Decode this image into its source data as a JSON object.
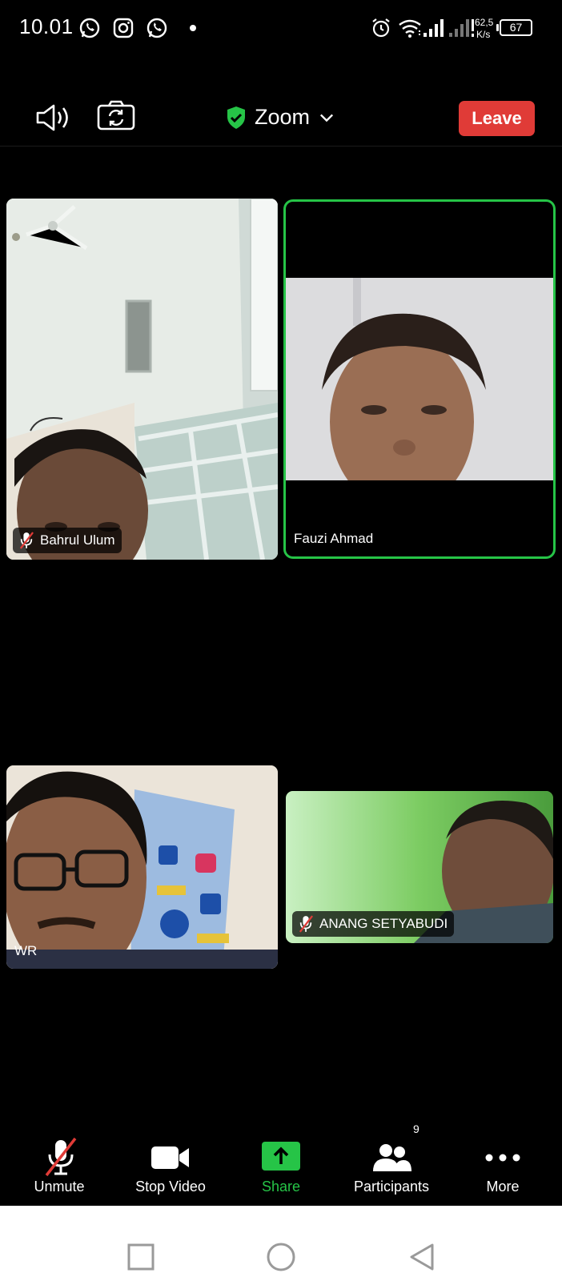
{
  "status_bar": {
    "time": "10.01",
    "net_speed_value": "62,5",
    "net_speed_unit": "K/s",
    "battery": "67",
    "notification_icons": [
      "whatsapp-icon",
      "instagram-icon",
      "whatsapp-icon"
    ]
  },
  "header": {
    "title": "Zoom",
    "leave_label": "Leave"
  },
  "participants": [
    {
      "name": "Bahrul Ulum",
      "muted": true
    },
    {
      "name": "Fauzi Ahmad",
      "muted": false,
      "active_speaker": true
    },
    {
      "name": "WR",
      "muted": false
    },
    {
      "name": "ANANG SETYABUDI",
      "muted": true
    }
  ],
  "toolbar": {
    "unmute": "Unmute",
    "stop_video": "Stop Video",
    "share": "Share",
    "participants": "Participants",
    "participants_count": "9",
    "more": "More"
  },
  "colors": {
    "leave": "#e03b37",
    "share": "#26c447",
    "active_border": "#26c447",
    "shield": "#26c447"
  }
}
